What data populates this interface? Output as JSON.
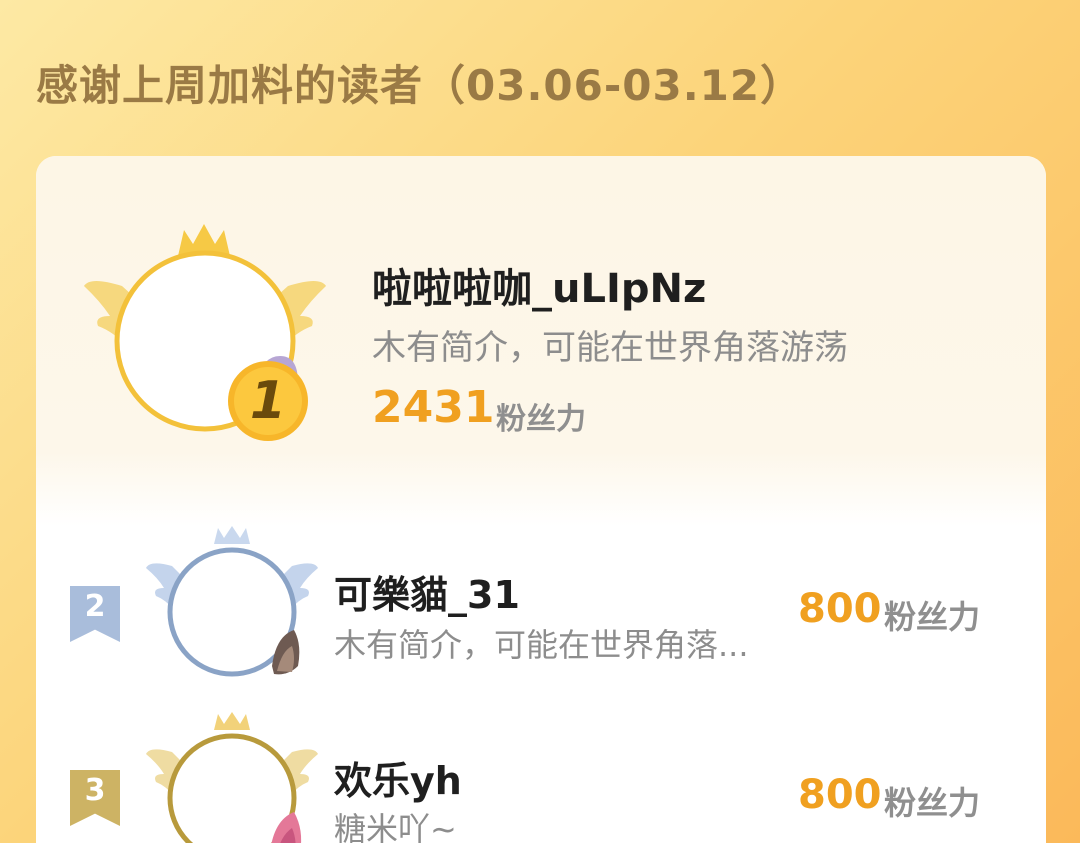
{
  "header": {
    "title": "感谢上周加料的读者（03.06-03.12）"
  },
  "colors": {
    "gold": "#f3c13a",
    "silver_blue": "#8aa3c6",
    "bronze": "#c6a84a",
    "points": "#f0a020",
    "title": "#9a7a45"
  },
  "readers": [
    {
      "rank": "1",
      "name": "啦啦啦咖_uLIpNz",
      "bio": "木有简介，可能在世界角落游荡",
      "points": "2431",
      "unit": "粉丝力",
      "frame_icon": "gold-crown-wings-frame"
    },
    {
      "rank": "2",
      "name": "可樂貓_31",
      "bio": "木有简介，可能在世界角落...",
      "points": "800",
      "unit": "粉丝力",
      "frame_icon": "silver-crown-wings-frame"
    },
    {
      "rank": "3",
      "name": "欢乐yh",
      "bio": "糖米吖~",
      "points": "800",
      "unit": "粉丝力",
      "frame_icon": "bronze-crown-wings-frame"
    }
  ]
}
